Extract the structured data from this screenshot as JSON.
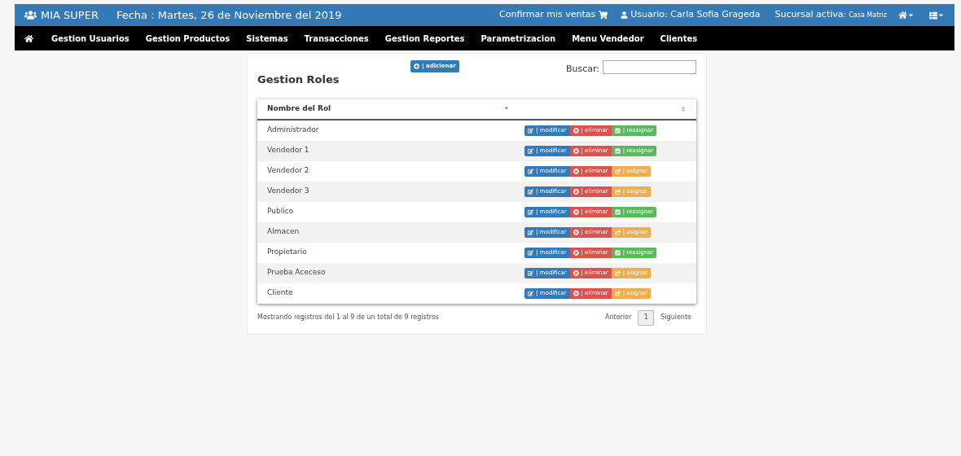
{
  "header": {
    "brand": "MIA SUPER",
    "date": "Fecha : Martes, 26 de Noviembre del 2019",
    "confirm": "Confirmar mis ventas",
    "user": "Usuario: Carla Sofia Grageda",
    "branch_label": "Sucursal activa:",
    "branch": "Casa Matriz"
  },
  "nav": [
    "Gestion Usuarios",
    "Gestion Productos",
    "Sistemas",
    "Transacciones",
    "Gestion Reportes",
    "Parametrizacion",
    "Menu Vendedor",
    "Clientes"
  ],
  "page": {
    "title": "Gestion Roles",
    "add_button": "| adicionar",
    "search_label": "Buscar:"
  },
  "table": {
    "columns": [
      "Nombre del Rol"
    ],
    "rows": [
      {
        "name": "Administrador",
        "edit": "| modificar",
        "delete": "| eliminar",
        "assign": "| reasignar",
        "kind": "reassign"
      },
      {
        "name": "Vendedor 1",
        "edit": "| modificar",
        "delete": "| eliminar",
        "assign": "| reasignar",
        "kind": "reassign"
      },
      {
        "name": "Vendedor 2",
        "edit": "| modificar",
        "delete": "| eliminar",
        "assign": "| asignar",
        "kind": "assign"
      },
      {
        "name": "Vendedor 3",
        "edit": "| modificar",
        "delete": "| eliminar",
        "assign": "| asignar",
        "kind": "assign"
      },
      {
        "name": "Publico",
        "edit": "| modificar",
        "delete": "| eliminar",
        "assign": "| reasignar",
        "kind": "reassign"
      },
      {
        "name": "Almacen",
        "edit": "| modificar",
        "delete": "| eliminar",
        "assign": "| asignar",
        "kind": "assign"
      },
      {
        "name": "Propietario",
        "edit": "| modificar",
        "delete": "| eliminar",
        "assign": "| reasignar",
        "kind": "reassign"
      },
      {
        "name": "Prueba Aceceso",
        "edit": "| modificar",
        "delete": "| eliminar",
        "assign": "| asignar",
        "kind": "assign"
      },
      {
        "name": "Cliente",
        "edit": "| modificar",
        "delete": "| eliminar",
        "assign": "| asignar",
        "kind": "assign"
      }
    ]
  },
  "footer": {
    "info": "Mostrando registros del 1 al 9 de un total de 9 registros",
    "prev": "Anterior",
    "pages": [
      {
        "label": "1",
        "selected": true
      }
    ],
    "next": "Siguiente"
  }
}
